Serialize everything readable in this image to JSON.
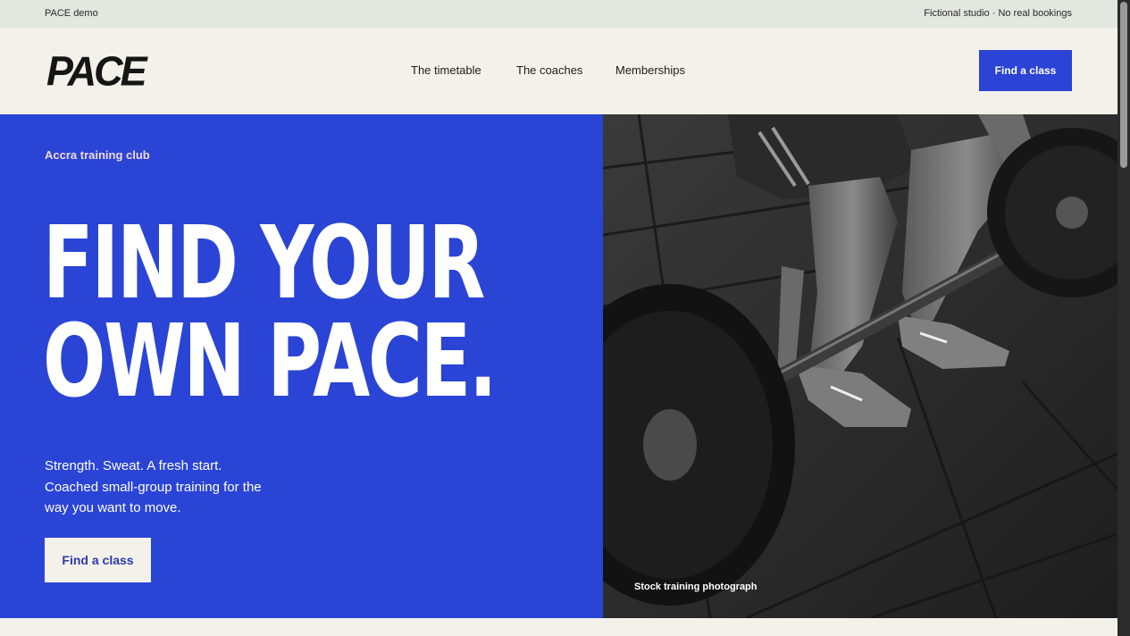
{
  "topbar": {
    "left_text": "PACE demo",
    "right_text": "Fictional studio · No real bookings"
  },
  "header": {
    "logo": "PACE",
    "nav": [
      "The timetable",
      "The coaches",
      "Memberships"
    ],
    "cta": "Find a class"
  },
  "hero": {
    "eyebrow": "Accra training club",
    "headline_line1": "FIND YOUR",
    "headline_line2": "OWN PACE.",
    "subtext": "Strength. Sweat. A fresh start. Coached small-group training for the way you want to move.",
    "cta": "Find a class",
    "image_caption": "Stock training photograph"
  },
  "colors": {
    "brand_blue": "#2a44d6",
    "cream": "#f3f1ea",
    "topbar": "#e4e6e0"
  }
}
